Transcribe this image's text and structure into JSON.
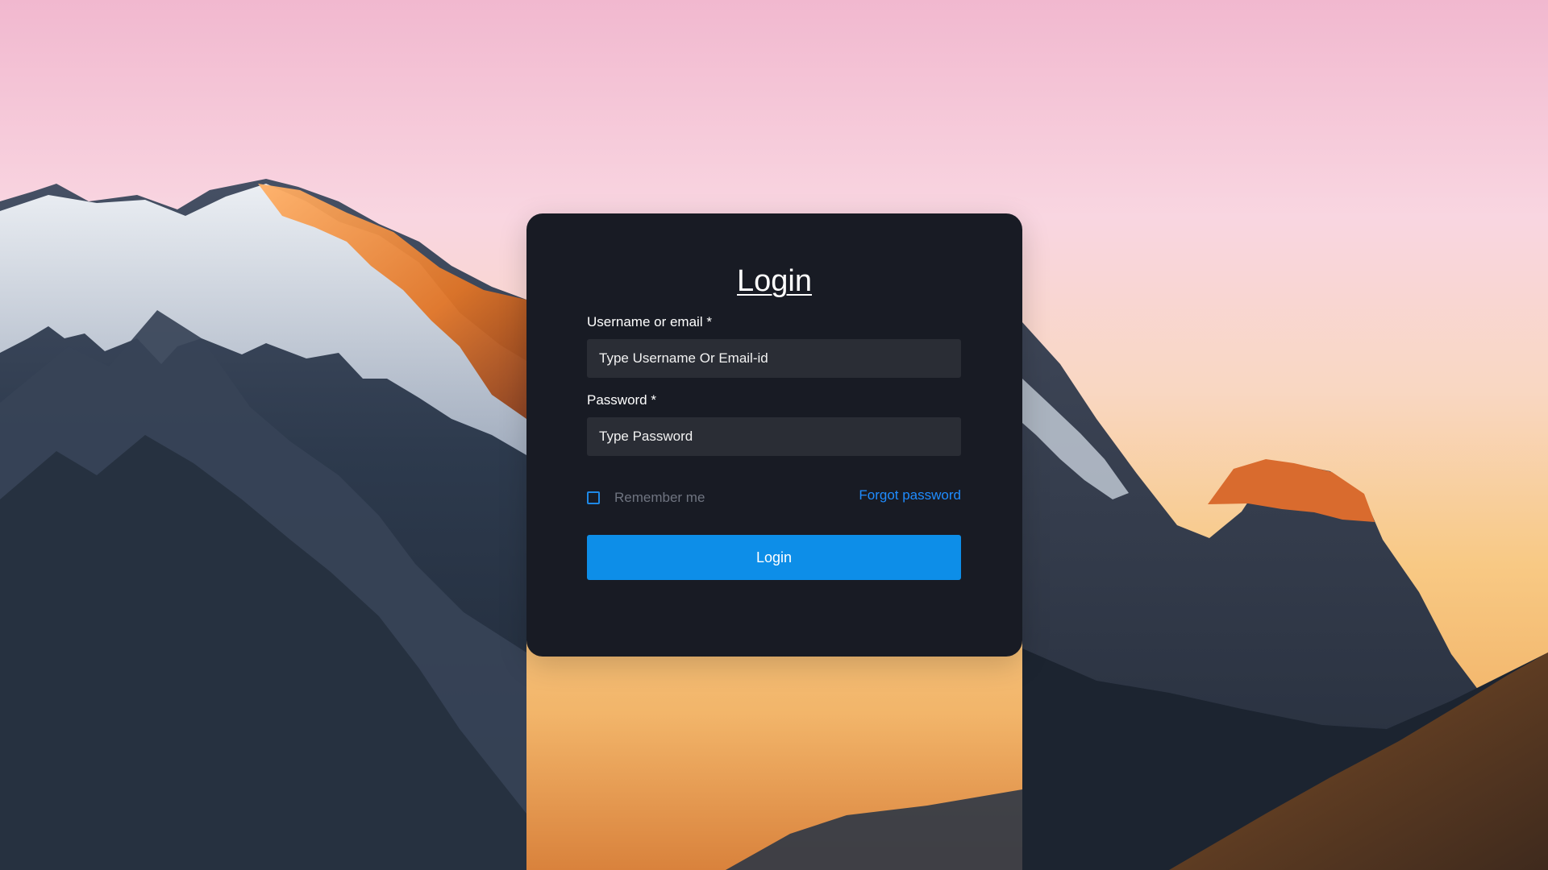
{
  "page": {
    "title": "Login"
  },
  "form": {
    "username_label": "Username or email *",
    "username_placeholder": "Type Username Or Email-id",
    "username_value": "",
    "password_label": "Password *",
    "password_placeholder": "Type Password",
    "password_value": "",
    "remember_label": "Remember me",
    "remember_checked": false,
    "forgot_label": "Forgot password",
    "submit_label": "Login"
  },
  "colors": {
    "card_background": "#181b24",
    "input_background": "#2a2d35",
    "accent": "#0d8ee8",
    "link": "#1f8cff",
    "muted_text": "#6f7480"
  }
}
